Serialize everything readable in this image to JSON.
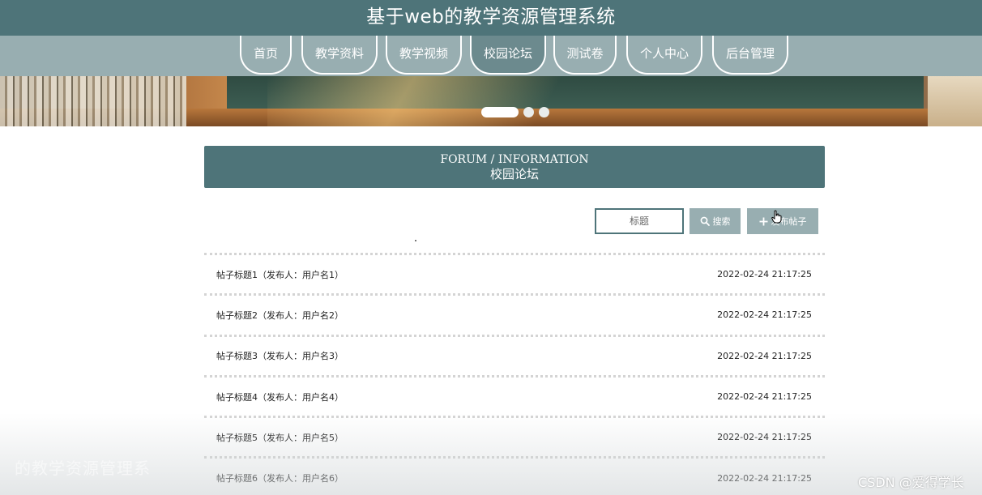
{
  "site": {
    "title": "基于web的教学资源管理系统"
  },
  "nav": {
    "items": [
      {
        "label": "首页"
      },
      {
        "label": "教学资料"
      },
      {
        "label": "教学视频"
      },
      {
        "label": "校园论坛"
      },
      {
        "label": "测试卷"
      },
      {
        "label": "个人中心"
      },
      {
        "label": "后台管理"
      }
    ],
    "active": "校园论坛"
  },
  "banner": {
    "slide_count": 3,
    "active_slide": 1
  },
  "section": {
    "title_en": "FORUM / INFORMATION",
    "title_cn": "校园论坛"
  },
  "search": {
    "placeholder": "标题",
    "search_label": "搜索",
    "post_label": "发布帖子"
  },
  "posts": [
    {
      "title": "帖子标题1（发布人：用户名1）",
      "time": "2022-02-24 21:17:25"
    },
    {
      "title": "帖子标题2（发布人：用户名2）",
      "time": "2022-02-24 21:17:25"
    },
    {
      "title": "帖子标题3（发布人：用户名3）",
      "time": "2022-02-24 21:17:25"
    },
    {
      "title": "帖子标题4（发布人：用户名4）",
      "time": "2022-02-24 21:17:25"
    },
    {
      "title": "帖子标题5（发布人：用户名5）",
      "time": "2022-02-24 21:17:25"
    },
    {
      "title": "帖子标题6（发布人：用户名6）",
      "time": "2022-02-24 21:17:25"
    }
  ],
  "overlay": {
    "ghost_text": "的教学资源管理系",
    "watermark": "CSDN @爱得学长"
  },
  "colors": {
    "primary": "#4e7479",
    "secondary": "#98aeb1"
  },
  "icons": {
    "search": "search-icon",
    "post": "plus-icon",
    "cursor": "hand-pointer-icon"
  }
}
